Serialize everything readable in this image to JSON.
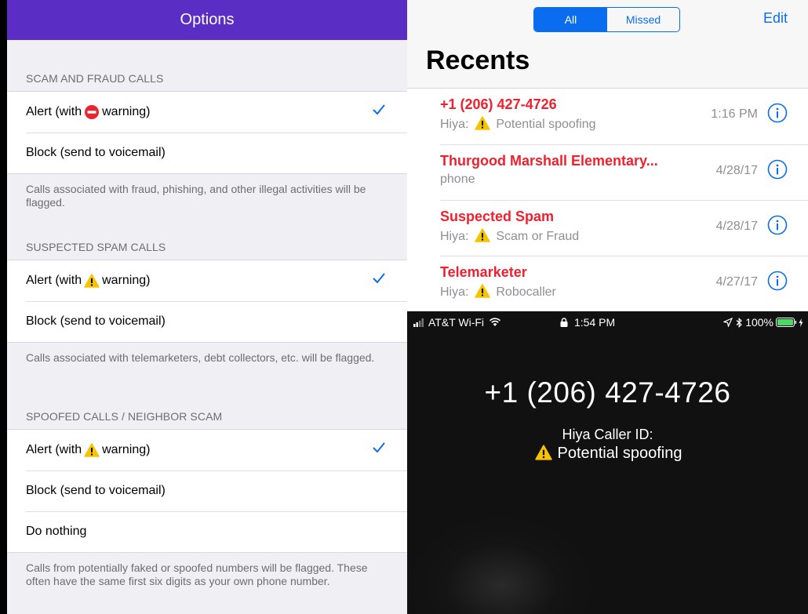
{
  "options": {
    "title": "Options",
    "sections": [
      {
        "header": "SCAM AND FRAUD CALLS",
        "rows": [
          {
            "prefix": "Alert (with",
            "icon": "no-entry-icon",
            "suffix": "warning)",
            "checked": true
          },
          {
            "label": "Block (send to voicemail)"
          }
        ],
        "footer": "Calls associated with fraud, phishing, and other illegal activities will be flagged."
      },
      {
        "header": "SUSPECTED SPAM CALLS",
        "rows": [
          {
            "prefix": "Alert (with",
            "icon": "warning-icon",
            "suffix": "warning)",
            "checked": true
          },
          {
            "label": "Block (send to voicemail)"
          }
        ],
        "footer": "Calls associated with telemarketers, debt collectors, etc. will be flagged."
      },
      {
        "header": "SPOOFED CALLS / NEIGHBOR SCAM",
        "rows": [
          {
            "prefix": "Alert (with",
            "icon": "warning-icon",
            "suffix": "warning)",
            "checked": true
          },
          {
            "label": "Block (send to voicemail)"
          },
          {
            "label": "Do nothing"
          }
        ],
        "footer": "Calls from potentially faked or spoofed numbers will be flagged. These often have the same first six digits as your own phone number."
      }
    ]
  },
  "recents": {
    "segments": {
      "all": "All",
      "missed": "Missed"
    },
    "edit": "Edit",
    "title": "Recents",
    "calls": [
      {
        "name": "+1 (206) 427-4726",
        "sub_prefix": "Hiya:",
        "sub_icon": "warning-icon",
        "sub_text": "Potential spoofing",
        "time": "1:16 PM"
      },
      {
        "name": "Thurgood Marshall Elementary...",
        "sub_text": "phone",
        "time": "4/28/17"
      },
      {
        "name": "Suspected Spam",
        "sub_prefix": "Hiya:",
        "sub_icon": "warning-icon",
        "sub_text": "Scam or Fraud",
        "time": "4/28/17"
      },
      {
        "name": "Telemarketer",
        "sub_prefix": "Hiya:",
        "sub_icon": "warning-icon",
        "sub_text": "Robocaller",
        "time": "4/27/17"
      }
    ]
  },
  "incoming": {
    "status": {
      "carrier": "AT&T Wi-Fi",
      "time": "1:54 PM",
      "battery": "100%"
    },
    "number": "+1 (206) 427-4726",
    "label": "Hiya Caller ID:",
    "status_text": "Potential spoofing"
  },
  "colors": {
    "header_purple": "#5a2ec4",
    "ios_blue": "#0a6df0",
    "alert_red": "#f0202e",
    "warning_yellow": "#f7c300"
  }
}
